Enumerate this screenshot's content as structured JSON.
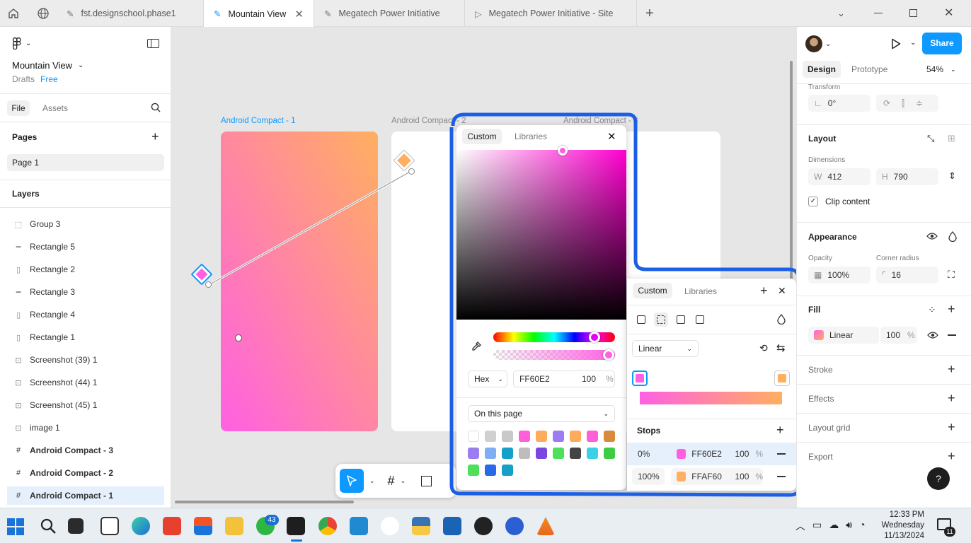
{
  "tabs": {
    "tab1": "fst.designschool.phase1",
    "tab2": "Mountain View",
    "tab3": "Megatech Power Initiative",
    "tab4": "Megatech Power Initiative - Site"
  },
  "file": {
    "name": "Mountain View",
    "drafts": "Drafts",
    "plan": "Free"
  },
  "left_tabs": {
    "file": "File",
    "assets": "Assets"
  },
  "pages": {
    "heading": "Pages",
    "items": [
      "Page 1"
    ]
  },
  "layers": {
    "heading": "Layers",
    "items": [
      {
        "name": "Group 3",
        "icon": "group-icon"
      },
      {
        "name": "Rectangle 5",
        "icon": "line-icon"
      },
      {
        "name": "Rectangle 2",
        "icon": "rect-icon"
      },
      {
        "name": "Rectangle 3",
        "icon": "line-icon"
      },
      {
        "name": "Rectangle 4",
        "icon": "rect-icon"
      },
      {
        "name": "Rectangle 1",
        "icon": "rect-icon"
      },
      {
        "name": "Screenshot (39) 1",
        "icon": "image-icon"
      },
      {
        "name": "Screenshot (44) 1",
        "icon": "image-icon"
      },
      {
        "name": "Screenshot (45) 1",
        "icon": "image-icon"
      },
      {
        "name": "image 1",
        "icon": "image-icon"
      },
      {
        "name": "Android Compact - 3",
        "icon": "frame-icon"
      },
      {
        "name": "Android Compact - 2",
        "icon": "frame-icon"
      },
      {
        "name": "Android Compact - 1",
        "icon": "frame-icon"
      }
    ]
  },
  "canvas": {
    "frame1_label": "Android Compact - 1",
    "frame2_label": "Android Compact - 2",
    "frame3_label": "Android Compact - 3"
  },
  "picker": {
    "tab_custom": "Custom",
    "tab_libraries": "Libraries",
    "format": "Hex",
    "hex": "FF60E2",
    "opacity": "100",
    "percent": "%",
    "library_select": "On this page",
    "swatches": [
      "#ffffff",
      "#d0d0d0",
      "#c9c9c9",
      "#ff5fd8",
      "#ffab5c",
      "#9b7df2",
      "#ffab5c",
      "#ff5fd8",
      "#d88a3d",
      "#9b7df2",
      "#7faef5",
      "#16a0c8",
      "#bdbdbd",
      "#7b47e3",
      "#4ee05a",
      "#444444",
      "#3bd0e6",
      "#3ccd44",
      "#4ee05a",
      "#2769e8",
      "#16a0c8"
    ]
  },
  "fill_popup": {
    "tab_custom": "Custom",
    "tab_libraries": "Libraries",
    "type": "Linear",
    "stops_heading": "Stops",
    "stops": [
      {
        "position": "0%",
        "hex": "FF60E2",
        "opacity": "100",
        "color": "#ff60e2"
      },
      {
        "position": "100%",
        "hex": "FFAF60",
        "opacity": "100",
        "color": "#ffaf60"
      }
    ]
  },
  "right": {
    "share": "Share",
    "tab_design": "Design",
    "tab_prototype": "Prototype",
    "zoom": "54%",
    "transform": "Transform",
    "rotation": "0°",
    "layout": "Layout",
    "dimensions": "Dimensions",
    "w_label": "W",
    "w": "412",
    "h_label": "H",
    "h": "790",
    "clip": "Clip content",
    "appearance": "Appearance",
    "opacity_label": "Opacity",
    "corner_label": "Corner radius",
    "opacity": "100%",
    "corner": "16",
    "fill": "Fill",
    "fill_type": "Linear",
    "fill_opacity": "100",
    "stroke": "Stroke",
    "effects": "Effects",
    "layout_grid": "Layout grid",
    "export": "Export",
    "help": "?"
  },
  "taskbar": {
    "whatsapp_badge": "43",
    "time": "12:33 PM",
    "day": "Wednesday",
    "date": "11/13/2024",
    "notif": "11"
  },
  "colors": {
    "accent": "#0d99ff",
    "gradient_start": "#ff60e2",
    "gradient_end": "#ffaf60",
    "highlight": "#1a5fe6"
  }
}
